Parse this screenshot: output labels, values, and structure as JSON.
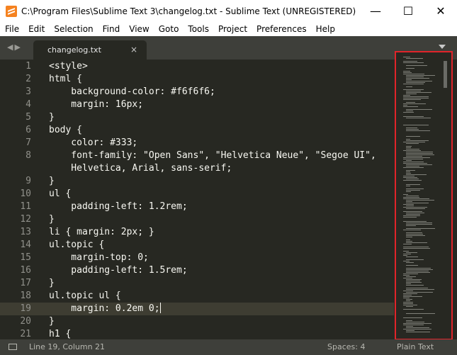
{
  "window": {
    "title": "C:\\Program Files\\Sublime Text 3\\changelog.txt - Sublime Text (UNREGISTERED)",
    "minimize": "—",
    "maximize": "☐",
    "close": "✕"
  },
  "menu": [
    "File",
    "Edit",
    "Selection",
    "Find",
    "View",
    "Goto",
    "Tools",
    "Project",
    "Preferences",
    "Help"
  ],
  "tabs": {
    "nav": "◀▶",
    "active_label": "changelog.txt",
    "close": "×"
  },
  "editor": {
    "lines": [
      {
        "num": "1",
        "text": "<style>"
      },
      {
        "num": "2",
        "text": "html {"
      },
      {
        "num": "3",
        "text": "    background-color: #f6f6f6;"
      },
      {
        "num": "4",
        "text": "    margin: 16px;"
      },
      {
        "num": "5",
        "text": "}"
      },
      {
        "num": "6",
        "text": "body {"
      },
      {
        "num": "7",
        "text": "    color: #333;"
      },
      {
        "num": "8",
        "text": "    font-family: \"Open Sans\", \"Helvetica Neue\", \"Segoe UI\","
      },
      {
        "num": "",
        "text": "    Helvetica, Arial, sans-serif;"
      },
      {
        "num": "9",
        "text": "}"
      },
      {
        "num": "10",
        "text": "ul {"
      },
      {
        "num": "11",
        "text": "    padding-left: 1.2rem;"
      },
      {
        "num": "12",
        "text": "}"
      },
      {
        "num": "13",
        "text": "li { margin: 2px; }"
      },
      {
        "num": "14",
        "text": "ul.topic {"
      },
      {
        "num": "15",
        "text": "    margin-top: 0;"
      },
      {
        "num": "16",
        "text": "    padding-left: 1.5rem;"
      },
      {
        "num": "17",
        "text": "}"
      },
      {
        "num": "18",
        "text": "ul.topic ul {"
      },
      {
        "num": "19",
        "text": "    margin: 0.2em 0;"
      },
      {
        "num": "20",
        "text": "}"
      },
      {
        "num": "21",
        "text": "h1 {"
      }
    ],
    "active_line": "19",
    "colors": {
      "background": "#272822",
      "active_line": "#3e3d32",
      "text": "#f8f8f2",
      "gutter": "#90908a"
    }
  },
  "minimap": {
    "highlight_color": "#e0242a"
  },
  "status": {
    "position": "Line 19, Column 21",
    "spaces": "Spaces: 4",
    "syntax": "Plain Text"
  }
}
